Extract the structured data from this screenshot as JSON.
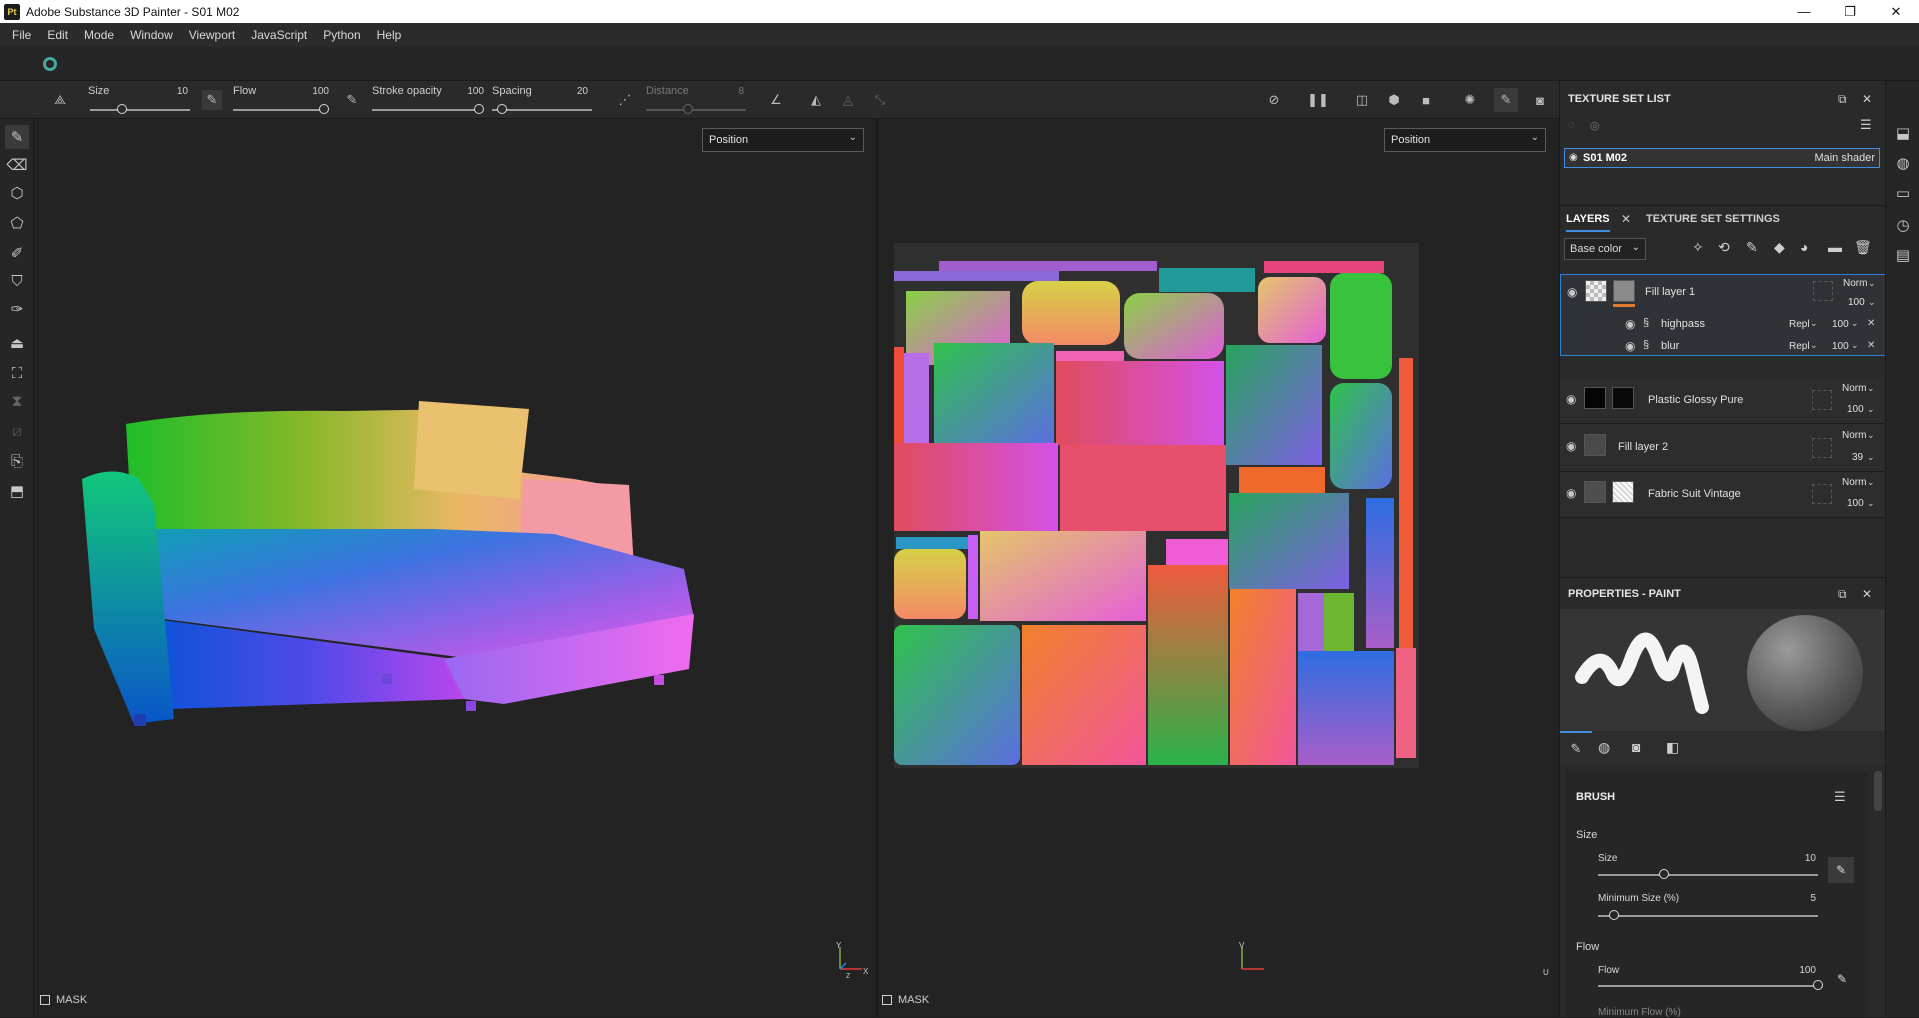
{
  "window": {
    "app_icon": "Pt",
    "title": "Adobe Substance 3D Painter - S01 M02",
    "minimize": "—",
    "maximize": "❐",
    "close": "✕"
  },
  "menu": [
    "File",
    "Edit",
    "Mode",
    "Window",
    "Viewport",
    "JavaScript",
    "Python",
    "Help"
  ],
  "toolbar": {
    "size_label": "Size",
    "size_value": "10",
    "flow_label": "Flow",
    "flow_value": "100",
    "stroke_opacity_label": "Stroke opacity",
    "stroke_opacity_value": "100",
    "spacing_label": "Spacing",
    "spacing_value": "20",
    "distance_label": "Distance",
    "distance_value": "8"
  },
  "viewport_3d": {
    "channel": "Position",
    "mask_label": "MASK",
    "axis_y": "Y",
    "axis_x": "X",
    "axis_z": "Z"
  },
  "viewport_2d": {
    "channel": "Position",
    "mask_label": "MASK",
    "axis_v": "V",
    "axis_u": "U"
  },
  "texture_set_list": {
    "title": "TEXTURE SET LIST",
    "set_name": "S01 M02",
    "shader": "Main shader"
  },
  "layers_panel": {
    "tab_layers": "LAYERS",
    "tab_texture_set_settings": "TEXTURE SET SETTINGS",
    "channel": "Base color",
    "layers": [
      {
        "name": "Fill layer 1",
        "blend": "Norm",
        "opacity": "100"
      },
      {
        "name": "Plastic Glossy Pure",
        "blend": "Norm",
        "opacity": "100"
      },
      {
        "name": "Fill layer 2",
        "blend": "Norm",
        "opacity": "39"
      },
      {
        "name": "Fabric Suit Vintage",
        "blend": "Norm",
        "opacity": "100"
      }
    ],
    "filters": [
      {
        "name": "highpass",
        "blend": "Repl",
        "opacity": "100"
      },
      {
        "name": "blur",
        "blend": "Repl",
        "opacity": "100"
      }
    ]
  },
  "properties": {
    "title": "PROPERTIES - PAINT",
    "brush_section": "BRUSH",
    "size_group": "Size",
    "size_label": "Size",
    "size_value": "10",
    "min_size_label": "Minimum Size (%)",
    "min_size_value": "5",
    "flow_group": "Flow",
    "flow_label": "Flow",
    "flow_value": "100",
    "min_flow_label": "Minimum Flow (%)"
  },
  "colors": {
    "accent": "#3f8ee0",
    "active_layer_border": "#2f7fd6",
    "fill_bar": "#e07a2c"
  }
}
